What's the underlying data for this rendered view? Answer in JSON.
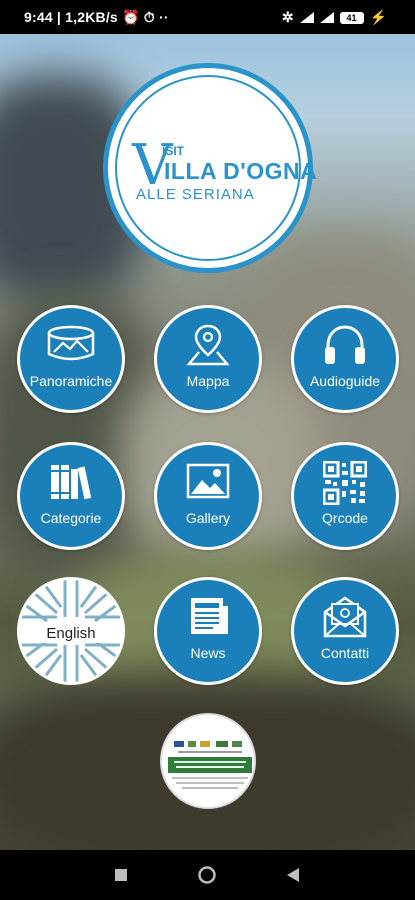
{
  "status_bar": {
    "time": "9:44",
    "net_speed": "1,2KB/s",
    "battery": "41"
  },
  "logo": {
    "v_letter": "V",
    "isit": "ISIT",
    "main": "ILLA D'OGNA",
    "sub": "ALLE SERIANA"
  },
  "menu": {
    "panoramiche": "Panoramiche",
    "mappa": "Mappa",
    "audioguide": "Audioguide",
    "categorie": "Categorie",
    "gallery": "Gallery",
    "qrcode": "Qrcode",
    "english": "English",
    "news": "News",
    "contatti": "Contatti"
  },
  "colors": {
    "accent": "#1b80ba",
    "logo_blue": "#2a93c9"
  }
}
